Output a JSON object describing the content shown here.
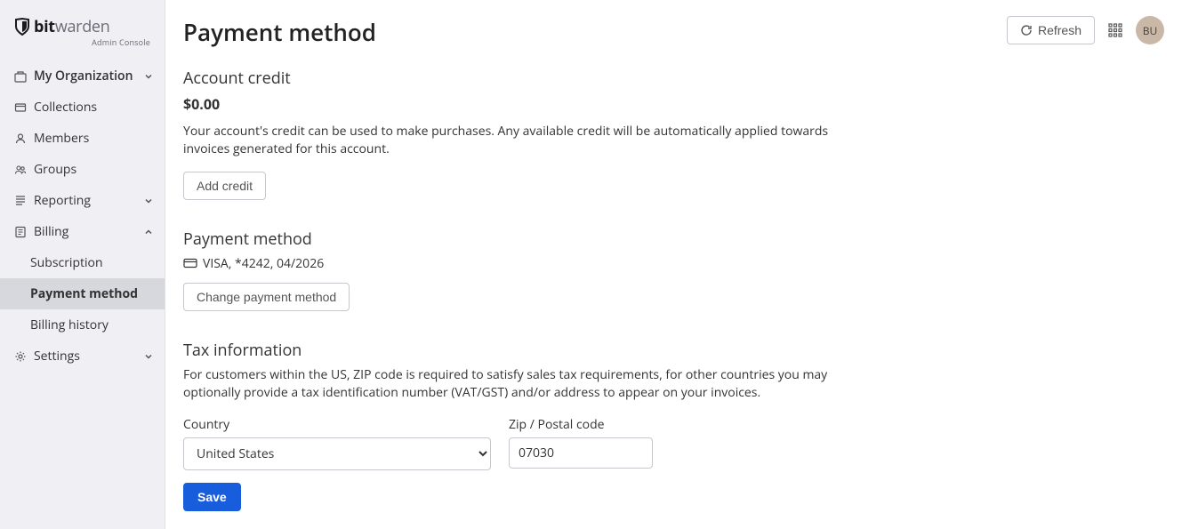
{
  "brand": {
    "name_bold": "bit",
    "name_light": "warden",
    "subtitle": "Admin Console"
  },
  "sidebar": {
    "items": [
      {
        "label": "My Organization",
        "icon": "org",
        "bold": true,
        "chevron": "down"
      },
      {
        "label": "Collections",
        "icon": "collections"
      },
      {
        "label": "Members",
        "icon": "members"
      },
      {
        "label": "Groups",
        "icon": "groups"
      },
      {
        "label": "Reporting",
        "icon": "reporting",
        "chevron": "down"
      },
      {
        "label": "Billing",
        "icon": "billing",
        "chevron": "up"
      },
      {
        "label": "Subscription",
        "sub": true
      },
      {
        "label": "Payment method",
        "sub": true,
        "active": true
      },
      {
        "label": "Billing history",
        "sub": true
      },
      {
        "label": "Settings",
        "icon": "settings",
        "chevron": "down"
      }
    ]
  },
  "header": {
    "title": "Payment method",
    "refresh_label": "Refresh",
    "avatar_initials": "BU"
  },
  "account_credit": {
    "heading": "Account credit",
    "amount": "$0.00",
    "description": "Your account's credit can be used to make purchases. Any available credit will be automatically applied towards invoices generated for this account.",
    "add_button": "Add credit"
  },
  "payment_method": {
    "heading": "Payment method",
    "card_text": "VISA, *4242, 04/2026",
    "change_button": "Change payment method"
  },
  "tax": {
    "heading": "Tax information",
    "description": "For customers within the US, ZIP code is required to satisfy sales tax requirements, for other countries you may optionally provide a tax identification number (VAT/GST) and/or address to appear on your invoices.",
    "country_label": "Country",
    "country_value": "United States",
    "zip_label": "Zip / Postal code",
    "zip_value": "07030",
    "save_button": "Save"
  }
}
